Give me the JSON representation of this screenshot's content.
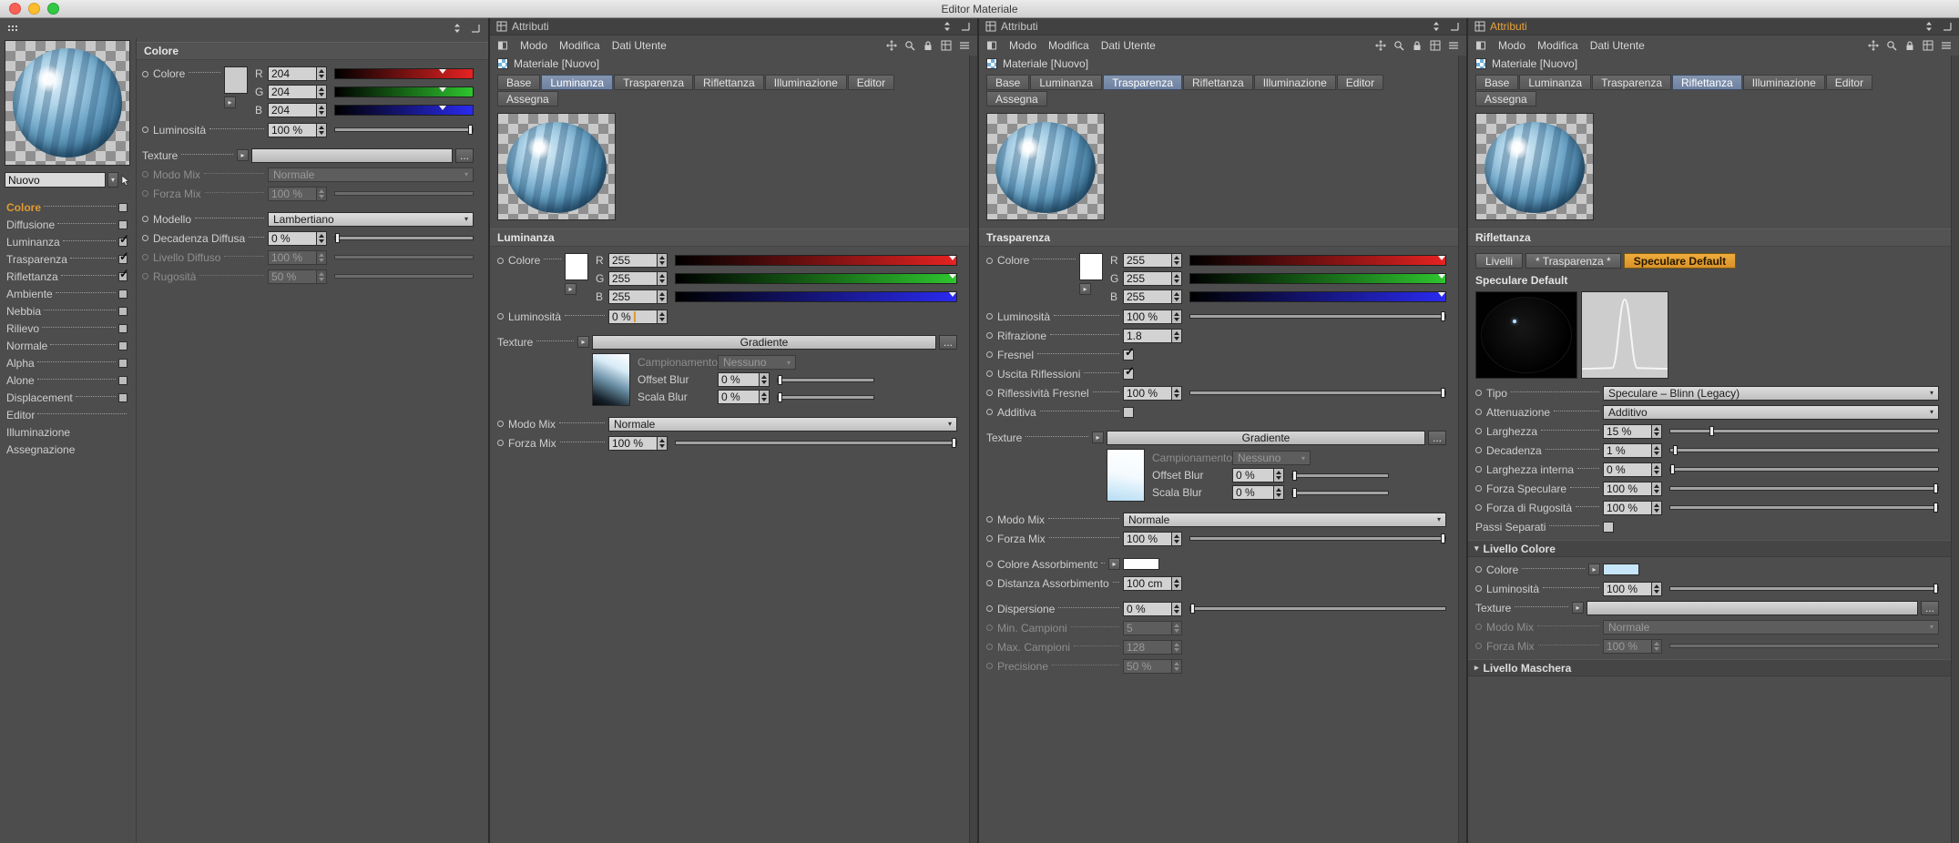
{
  "titlebar": {
    "title": "Editor Materiale"
  },
  "colors": {
    "accent": "#e09a31",
    "tab_active": "#7486a8"
  },
  "left_panel": {
    "material_name": "Nuovo",
    "section": "Colore",
    "channels": [
      {
        "label": "Colore",
        "box": true,
        "checked": false,
        "highlight": true
      },
      {
        "label": "Diffusione",
        "box": true,
        "checked": false
      },
      {
        "label": "Luminanza",
        "box": true,
        "checked": true
      },
      {
        "label": "Trasparenza",
        "box": true,
        "checked": true
      },
      {
        "label": "Riflettanza",
        "box": true,
        "checked": true
      },
      {
        "label": "Ambiente",
        "box": true,
        "checked": false
      },
      {
        "label": "Nebbia",
        "box": true,
        "checked": false
      },
      {
        "label": "Rilievo",
        "box": true,
        "checked": false
      },
      {
        "label": "Normale",
        "box": true,
        "checked": false
      },
      {
        "label": "Alpha",
        "box": true,
        "checked": false
      },
      {
        "label": "Alone",
        "box": true,
        "checked": false
      },
      {
        "label": "Displacement",
        "box": true,
        "checked": false
      },
      {
        "label": "Editor",
        "box": false,
        "dots": true
      },
      {
        "label": "Illuminazione",
        "box": false,
        "dots": false
      },
      {
        "label": "Assegnazione",
        "box": false,
        "dots": false
      }
    ],
    "rows": [
      {
        "type": "colorgroup",
        "label": "Colore",
        "dot": true,
        "swatch": "#cccccc",
        "channels": [
          {
            "letter": "R",
            "value": "204",
            "marker": 0.8,
            "grad": "red"
          },
          {
            "letter": "G",
            "value": "204",
            "marker": 0.8,
            "grad": "green"
          },
          {
            "letter": "B",
            "value": "204",
            "marker": 0.8,
            "grad": "blue"
          }
        ]
      },
      {
        "type": "slider",
        "label": "Luminosità",
        "value": "100 %",
        "pos": 1,
        "dot": true
      },
      {
        "type": "gap"
      },
      {
        "type": "texture",
        "label": "Texture",
        "button": "",
        "more": "..."
      },
      {
        "type": "dropdown",
        "label": "Modo Mix",
        "value": "Normale",
        "dot": true,
        "enabled": false
      },
      {
        "type": "slider",
        "label": "Forza Mix",
        "value": "100 %",
        "pos": 1,
        "dot": true,
        "enabled": false
      },
      {
        "type": "gap"
      },
      {
        "type": "dropdown",
        "label": "Modello",
        "value": "Lambertiano",
        "dot": true
      },
      {
        "type": "slider",
        "label": "Decadenza Diffusa",
        "value": "0 %",
        "pos": 0,
        "dot": true
      },
      {
        "type": "slider",
        "label": "Livello Diffuso",
        "value": "100 %",
        "pos": 1,
        "dot": true,
        "enabled": false
      },
      {
        "type": "slider",
        "label": "Rugosità",
        "value": "50 %",
        "pos": 0.5,
        "dot": true,
        "enabled": false
      }
    ]
  },
  "panels": [
    {
      "title": "Attributi",
      "accent": false,
      "menu": [
        "Modo",
        "Modifica",
        "Dati Utente"
      ],
      "material": "Materiale [Nuovo]",
      "tabs": [
        "Base",
        "Luminanza",
        "Trasparenza",
        "Riflettanza",
        "Illuminazione",
        "Editor"
      ],
      "active_tab": 1,
      "tabs2": [
        "Assegna"
      ],
      "section": "Luminanza",
      "rows": [
        {
          "type": "colorgroup",
          "label": "Colore",
          "dot": true,
          "swatch": "#ffffff",
          "channels": [
            {
              "letter": "R",
              "value": "255",
              "marker": 1,
              "grad": "red"
            },
            {
              "letter": "G",
              "value": "255",
              "marker": 1,
              "grad": "green"
            },
            {
              "letter": "B",
              "value": "255",
              "marker": 1,
              "grad": "blue"
            }
          ]
        },
        {
          "type": "field",
          "label": "Luminosità",
          "value": "0 %",
          "dot": true,
          "caret": true
        },
        {
          "type": "gap"
        },
        {
          "type": "texture",
          "label": "Texture",
          "button": "Gradiente",
          "more": "..."
        },
        {
          "type": "texblock",
          "thumb": "luminance",
          "rows": [
            {
              "type": "dropdown",
              "label": "Campionamento",
              "value": "Nessuno",
              "enabled": false
            },
            {
              "type": "mslider",
              "label": "Offset Blur",
              "value": "0 %",
              "pos": 0
            },
            {
              "type": "mslider",
              "label": "Scala Blur",
              "value": "0 %",
              "pos": 0
            }
          ]
        },
        {
          "type": "gap"
        },
        {
          "type": "dropdown",
          "label": "Modo Mix",
          "value": "Normale",
          "dot": true
        },
        {
          "type": "slider",
          "label": "Forza Mix",
          "value": "100 %",
          "pos": 1,
          "dot": true
        }
      ]
    },
    {
      "title": "Attributi",
      "accent": false,
      "menu": [
        "Modo",
        "Modifica",
        "Dati Utente"
      ],
      "material": "Materiale [Nuovo]",
      "tabs": [
        "Base",
        "Luminanza",
        "Trasparenza",
        "Riflettanza",
        "Illuminazione",
        "Editor"
      ],
      "active_tab": 2,
      "tabs2": [
        "Assegna"
      ],
      "section": "Trasparenza",
      "rows": [
        {
          "type": "colorgroup",
          "label": "Colore",
          "dot": true,
          "swatch": "#ffffff",
          "channels": [
            {
              "letter": "R",
              "value": "255",
              "marker": 1,
              "grad": "red"
            },
            {
              "letter": "G",
              "value": "255",
              "marker": 1,
              "grad": "green"
            },
            {
              "letter": "B",
              "value": "255",
              "marker": 1,
              "grad": "blue"
            }
          ]
        },
        {
          "type": "slider",
          "label": "Luminosità",
          "value": "100 %",
          "pos": 1,
          "dot": true
        },
        {
          "type": "field",
          "label": "Rifrazione",
          "value": "1.8",
          "dot": true
        },
        {
          "type": "check",
          "label": "Fresnel",
          "checked": true,
          "dot": true
        },
        {
          "type": "check",
          "label": "Uscita Riflessioni",
          "checked": true,
          "dot": true
        },
        {
          "type": "slider",
          "label": "Riflessività Fresnel",
          "value": "100 %",
          "pos": 1,
          "dot": true
        },
        {
          "type": "check",
          "label": "Additiva",
          "checked": false,
          "dot": true
        },
        {
          "type": "gap"
        },
        {
          "type": "texture",
          "label": "Texture",
          "button": "Gradiente",
          "more": "..."
        },
        {
          "type": "texblock",
          "thumb": "transparency",
          "rows": [
            {
              "type": "dropdown",
              "label": "Campionamento",
              "value": "Nessuno",
              "enabled": false
            },
            {
              "type": "mslider",
              "label": "Offset Blur",
              "value": "0 %",
              "pos": 0
            },
            {
              "type": "mslider",
              "label": "Scala Blur",
              "value": "0 %",
              "pos": 0
            }
          ]
        },
        {
          "type": "gap"
        },
        {
          "type": "dropdown",
          "label": "Modo Mix",
          "value": "Normale",
          "dot": true
        },
        {
          "type": "slider",
          "label": "Forza Mix",
          "value": "100 %",
          "pos": 1,
          "dot": true
        },
        {
          "type": "gap"
        },
        {
          "type": "swatch",
          "label": "Colore Assorbimento",
          "swatch": "#ffffff",
          "dot": true
        },
        {
          "type": "field",
          "label": "Distanza Assorbimento",
          "value": "100 cm",
          "dot": true
        },
        {
          "type": "gap"
        },
        {
          "type": "slider",
          "label": "Dispersione",
          "value": "0 %",
          "pos": 0,
          "dot": true
        },
        {
          "type": "field",
          "label": "Min. Campioni",
          "value": "5",
          "dot": true,
          "enabled": false
        },
        {
          "type": "field",
          "label": "Max. Campioni",
          "value": "128",
          "dot": true,
          "enabled": false
        },
        {
          "type": "field",
          "label": "Precisione",
          "value": "50 %",
          "dot": true,
          "enabled": false
        }
      ]
    },
    {
      "title": "Attributi",
      "accent": true,
      "menu": [
        "Modo",
        "Modifica",
        "Dati Utente"
      ],
      "material": "Materiale [Nuovo]",
      "tabs": [
        "Base",
        "Luminanza",
        "Trasparenza",
        "Riflettanza",
        "Illuminazione",
        "Editor"
      ],
      "active_tab": 3,
      "tabs2": [
        "Assegna"
      ],
      "section": "Riflettanza",
      "rows": [
        {
          "type": "buttons",
          "items": [
            {
              "label": "Livelli"
            },
            {
              "label": "* Trasparenza *"
            },
            {
              "label": "Speculare Default",
              "accent": true
            }
          ]
        },
        {
          "type": "subheader",
          "label": "Speculare Default"
        },
        {
          "type": "previews"
        },
        {
          "type": "dropdown",
          "label": "Tipo",
          "value": "Speculare – Blinn (Legacy)",
          "dot": true
        },
        {
          "type": "dropdown",
          "label": "Attenuazione",
          "value": "Additivo",
          "dot": true
        },
        {
          "type": "slider",
          "label": "Larghezza",
          "value": "15 %",
          "pos": 0.15,
          "dot": true
        },
        {
          "type": "slider",
          "label": "Decadenza",
          "value": "1 %",
          "pos": 0.01,
          "dot": true
        },
        {
          "type": "slider",
          "label": "Larghezza interna",
          "value": "0 %",
          "pos": 0,
          "dot": true
        },
        {
          "type": "slider",
          "label": "Forza Speculare",
          "value": "100 %",
          "pos": 1,
          "dot": true
        },
        {
          "type": "slider",
          "label": "Forza di Rugosità",
          "value": "100 %",
          "pos": 1,
          "dot": true
        },
        {
          "type": "check",
          "label": "Passi Separati",
          "checked": false,
          "dot": false
        },
        {
          "type": "strip",
          "label": "Livello Colore",
          "open": true
        },
        {
          "type": "swatch",
          "label": "Colore",
          "swatch": "#c6e6f9",
          "dot": true
        },
        {
          "type": "slider",
          "label": "Luminosità",
          "value": "100 %",
          "pos": 1,
          "dot": true
        },
        {
          "type": "texture",
          "label": "Texture",
          "button": "",
          "more": "..."
        },
        {
          "type": "dropdown",
          "label": "Modo Mix",
          "value": "Normale",
          "dot": true,
          "enabled": false
        },
        {
          "type": "slider",
          "label": "Forza Mix",
          "value": "100 %",
          "pos": 1,
          "dot": true,
          "enabled": false
        },
        {
          "type": "strip",
          "label": "Livello Maschera",
          "open": false
        }
      ]
    }
  ]
}
